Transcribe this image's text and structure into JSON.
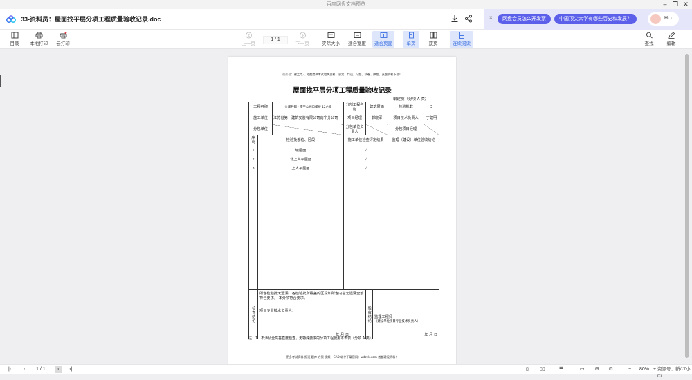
{
  "window": {
    "title": "百度网盘文档预览"
  },
  "header": {
    "doc_title": "33-资料员：屋面找平层分项工程质量验收记录.doc",
    "promo_1": "网盘会员怎么开发票",
    "promo_2": "中国顶尖大学有哪些历史和发展？",
    "avatar_label": "Hi ›"
  },
  "toolbar": {
    "directory": "目录",
    "local_print": "本地打印",
    "cloud_print": "云打印",
    "prev_page": "上一页",
    "page_indicator": "1 / 1",
    "next_page": "下一页",
    "actual_size": "实际大小",
    "fit_width": "适合宽度",
    "fit_page": "适合页面",
    "single_page": "单页",
    "double_page": "双页",
    "continuous": "连续阅读",
    "search": "查找",
    "edit": "编辑"
  },
  "document": {
    "header_note": "公众号：建工华人  免费提供考试相关资料、答案、口诀、习题、试卷、押题、真题资料下载！",
    "title": "屋面找平层分项工程质量验收记录",
    "form_code": "编建质（分项 A 类）",
    "labels": {
      "project_name": "工程名称",
      "project_value": "金城名都 · 南宁公园电梯楼 12#楼",
      "sub_project": "分部工程名  称",
      "sub_project_value": "建筑屋面",
      "batch_count": "检验批数",
      "batch_count_value": "3",
      "construction_unit": "施工单位",
      "construction_value": "江苏省第一建筑安装有限公司南宁分公司",
      "project_manager": "项目经理",
      "project_manager_value": "郭晓军",
      "tech_lead": "项目技术负责人",
      "tech_lead_value": "丁建明",
      "subcontract_unit": "分包单位",
      "subcontract_lead": "分包单位负责人",
      "subcontract_manager": "分包项目经理",
      "col_no": "序号",
      "col_part": "检验批部位、区段",
      "col_result": "施工单位检查评定结果",
      "col_accept": "监理（建设）单位验收结论"
    },
    "rows": [
      {
        "no": "1",
        "part": "坡屋面",
        "result": "√"
      },
      {
        "no": "2",
        "part": "非上人平屋面",
        "result": "√"
      },
      {
        "no": "3",
        "part": "上人平屋面",
        "result": "√"
      }
    ],
    "check_label": "检查结论",
    "check_text": "所含检验批无遗漏，各检验批所覆盖的区段和所含内容无遗漏全部符合要求，  本分项符合要求。",
    "check_sign": "项目专业技术负责人：",
    "date_text": "年  月  日",
    "accept_label": "验收结论",
    "accept_sign": "监理工程师",
    "accept_sub": "（建设单位项目专业技术负责人）",
    "footnote": "注：1．不涉及全高垂直度检查，无特殊要求的分项工程使用本表表（分项 A 类）。",
    "bottom_note": "更多考试资料 报班 题库 方案 视频，CAD 软件下载官网：wdzyk.com  首都建设资料！"
  },
  "statusbar": {
    "page_indicator": "1 / 1",
    "zoom": "80%",
    "corner_text": "资源号：新CT小Ci"
  }
}
